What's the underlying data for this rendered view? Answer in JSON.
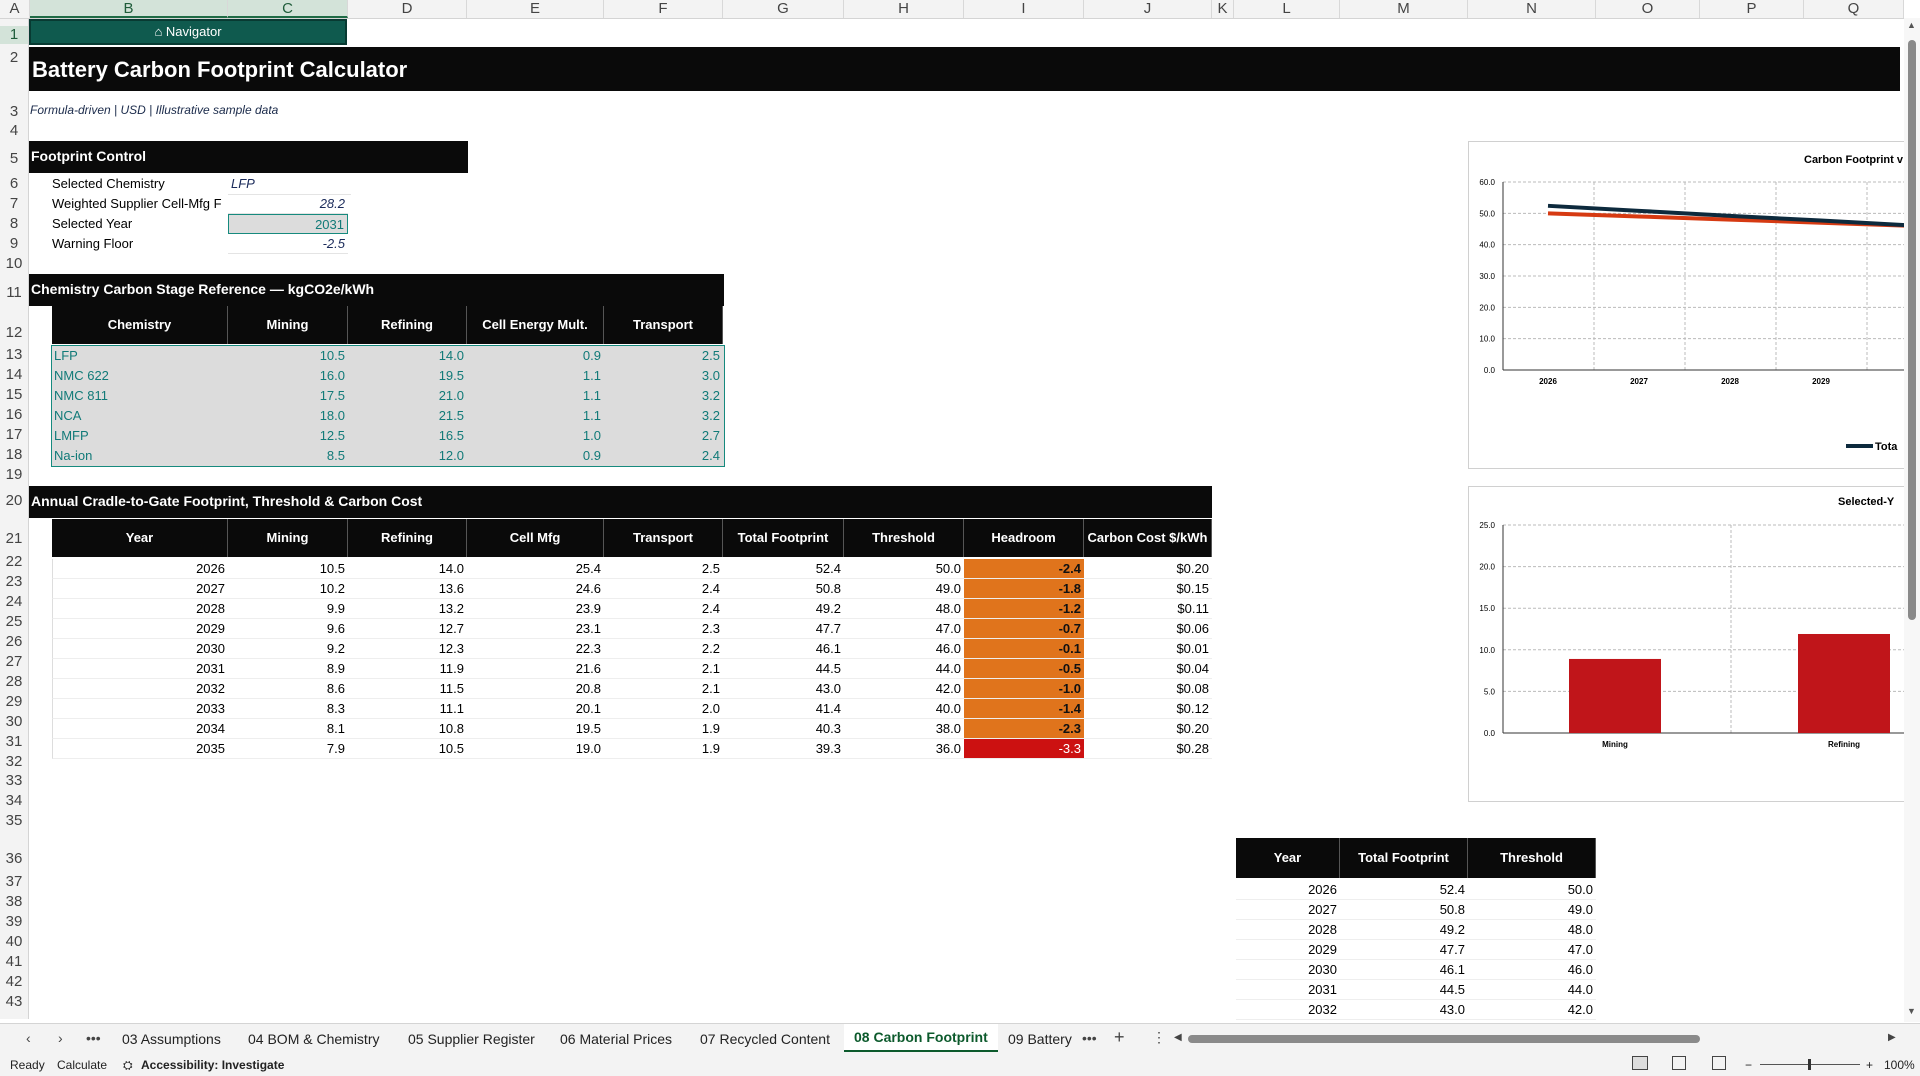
{
  "columns": [
    "A",
    "B",
    "C",
    "D",
    "E",
    "F",
    "G",
    "H",
    "I",
    "J",
    "K",
    "L",
    "M",
    "N",
    "O",
    "P",
    "Q"
  ],
  "rows": [
    "1",
    "2",
    "3",
    "4",
    "5",
    "6",
    "7",
    "8",
    "9",
    "10",
    "11",
    "12",
    "13",
    "14",
    "15",
    "16",
    "17",
    "18",
    "19",
    "20",
    "21",
    "22",
    "23",
    "24",
    "25",
    "26",
    "27",
    "28",
    "29",
    "30",
    "31",
    "32",
    "33",
    "34",
    "35",
    "36",
    "37",
    "38",
    "39",
    "40",
    "41",
    "42",
    "43"
  ],
  "navigator": {
    "icon": "home-icon",
    "label": "Navigator"
  },
  "title": "Battery Carbon Footprint Calculator",
  "subtitle": "Formula-driven | USD | Illustrative sample data",
  "control": {
    "header": "Footprint Control",
    "rows": [
      {
        "label": "Selected Chemistry",
        "value": "LFP"
      },
      {
        "label": "Weighted Supplier Cell-Mfg F",
        "value": "28.2"
      },
      {
        "label": "Selected Year",
        "value": "2031"
      },
      {
        "label": "Warning Floor",
        "value": "-2.5"
      }
    ]
  },
  "reference": {
    "header": "Chemistry Carbon Stage Reference — kgCO2e/kWh",
    "columns": [
      "Chemistry",
      "Mining",
      "Refining",
      "Cell Energy Mult.",
      "Transport"
    ],
    "rows": [
      [
        "LFP",
        "10.5",
        "14.0",
        "0.9",
        "2.5"
      ],
      [
        "NMC 622",
        "16.0",
        "19.5",
        "1.1",
        "3.0"
      ],
      [
        "NMC 811",
        "17.5",
        "21.0",
        "1.1",
        "3.2"
      ],
      [
        "NCA",
        "18.0",
        "21.5",
        "1.1",
        "3.2"
      ],
      [
        "LMFP",
        "12.5",
        "16.5",
        "1.0",
        "2.7"
      ],
      [
        "Na-ion",
        "8.5",
        "12.0",
        "0.9",
        "2.4"
      ]
    ]
  },
  "annual": {
    "header": "Annual Cradle-to-Gate Footprint, Threshold & Carbon Cost",
    "columns": [
      "Year",
      "Mining",
      "Refining",
      "Cell Mfg",
      "Transport",
      "Total Footprint",
      "Threshold",
      "Headroom",
      "Carbon Cost $/kWh"
    ],
    "rows": [
      [
        "2026",
        "10.5",
        "14.0",
        "25.4",
        "2.5",
        "52.4",
        "50.0",
        "-2.4",
        "$0.20"
      ],
      [
        "2027",
        "10.2",
        "13.6",
        "24.6",
        "2.4",
        "50.8",
        "49.0",
        "-1.8",
        "$0.15"
      ],
      [
        "2028",
        "9.9",
        "13.2",
        "23.9",
        "2.4",
        "49.2",
        "48.0",
        "-1.2",
        "$0.11"
      ],
      [
        "2029",
        "9.6",
        "12.7",
        "23.1",
        "2.3",
        "47.7",
        "47.0",
        "-0.7",
        "$0.06"
      ],
      [
        "2030",
        "9.2",
        "12.3",
        "22.3",
        "2.2",
        "46.1",
        "46.0",
        "-0.1",
        "$0.01"
      ],
      [
        "2031",
        "8.9",
        "11.9",
        "21.6",
        "2.1",
        "44.5",
        "44.0",
        "-0.5",
        "$0.04"
      ],
      [
        "2032",
        "8.6",
        "11.5",
        "20.8",
        "2.1",
        "43.0",
        "42.0",
        "-1.0",
        "$0.08"
      ],
      [
        "2033",
        "8.3",
        "11.1",
        "20.1",
        "2.0",
        "41.4",
        "40.0",
        "-1.4",
        "$0.12"
      ],
      [
        "2034",
        "8.1",
        "10.8",
        "19.5",
        "1.9",
        "40.3",
        "38.0",
        "-2.3",
        "$0.20"
      ],
      [
        "2035",
        "7.9",
        "10.5",
        "19.0",
        "1.9",
        "39.3",
        "36.0",
        "-3.3",
        "$0.28"
      ]
    ]
  },
  "mini": {
    "columns": [
      "Year",
      "Total Footprint",
      "Threshold"
    ],
    "rows": [
      [
        "2026",
        "52.4",
        "50.0"
      ],
      [
        "2027",
        "50.8",
        "49.0"
      ],
      [
        "2028",
        "49.2",
        "48.0"
      ],
      [
        "2029",
        "47.7",
        "47.0"
      ],
      [
        "2030",
        "46.1",
        "46.0"
      ],
      [
        "2031",
        "44.5",
        "44.0"
      ],
      [
        "2032",
        "43.0",
        "42.0"
      ]
    ]
  },
  "chart_data": [
    {
      "type": "line",
      "title": "Carbon Footprint v",
      "x": [
        "2026",
        "2027",
        "2028",
        "2029"
      ],
      "yticks": [
        "0.0",
        "10.0",
        "20.0",
        "30.0",
        "40.0",
        "50.0",
        "60.0"
      ],
      "ylim": [
        0,
        60
      ],
      "series": [
        {
          "name": "Tota",
          "color": "#0d2a3d",
          "values": [
            52.4,
            50.8,
            49.2,
            47.7,
            46.1
          ]
        },
        {
          "color": "#d63a12",
          "values": [
            50.0,
            49.0,
            48.0,
            47.0,
            46.0
          ]
        }
      ],
      "legend": "bottom"
    },
    {
      "type": "bar",
      "title": "Selected-Y",
      "categories": [
        "Mining",
        "Refining"
      ],
      "values": [
        8.9,
        11.9
      ],
      "yticks": [
        "0.0",
        "5.0",
        "10.0",
        "15.0",
        "20.0",
        "25.0"
      ],
      "ylim": [
        0,
        25
      ],
      "color": "#c0151a"
    }
  ],
  "sheet_tabs": [
    "03 Assumptions",
    "04 BOM & Chemistry",
    "05 Supplier Register",
    "06 Material Prices",
    "07 Recycled Content",
    "08 Carbon Footprint",
    "09 Battery"
  ],
  "active_tab": "08 Carbon Footprint",
  "status": {
    "ready": "Ready",
    "calculate": "Calculate",
    "accessibility": "Accessibility: Investigate",
    "zoom": "100%"
  }
}
